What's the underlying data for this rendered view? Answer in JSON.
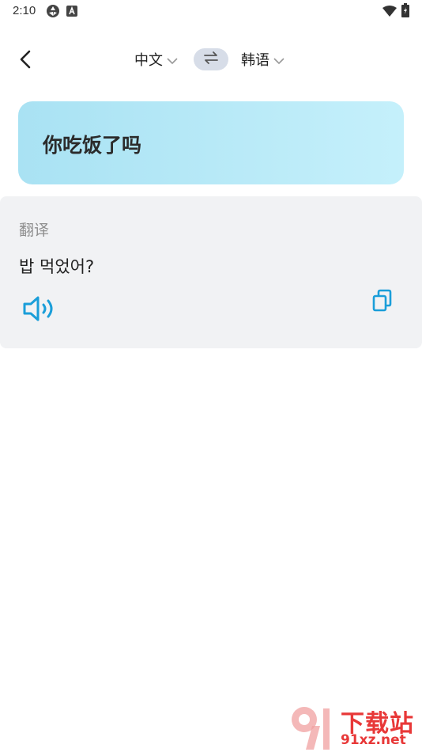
{
  "status_bar": {
    "time": "2:10",
    "icons": [
      "sync-icon",
      "text-a-icon",
      "wifi-icon",
      "battery-charging-icon"
    ]
  },
  "header": {
    "back_icon": "chevron-left-icon",
    "source_language": "中文",
    "target_language": "韩语",
    "swap_icon": "swap-arrows-icon"
  },
  "source": {
    "text": "你吃饭了吗"
  },
  "result": {
    "label": "翻译",
    "text": "밥 먹었어?",
    "speak_icon": "speaker-icon",
    "copy_icon": "copy-icon"
  },
  "watermark": {
    "title": "下载站",
    "url": "91xz.net"
  },
  "colors": {
    "accent": "#1a9ed9",
    "source_card_start": "#a9e2f3",
    "source_card_end": "#c5f0fb",
    "result_card_bg": "#f1f2f4",
    "swap_bg": "#d7dde8",
    "watermark": "#e83838"
  }
}
